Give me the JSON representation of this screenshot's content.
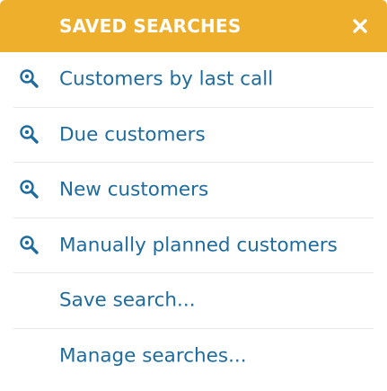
{
  "header": {
    "title": "SAVED SEARCHES",
    "close_icon": "close-icon"
  },
  "colors": {
    "header_bg": "#edaf2c",
    "header_text": "#ffffff",
    "link_text": "#1e6b9e",
    "divider": "#e7e9ec"
  },
  "saved_searches": [
    {
      "label": "Customers by last call",
      "icon": "search-icon"
    },
    {
      "label": "Due customers",
      "icon": "search-icon"
    },
    {
      "label": "New customers",
      "icon": "search-icon"
    },
    {
      "label": "Manually planned customers",
      "icon": "search-icon"
    }
  ],
  "actions": {
    "save_label": "Save search...",
    "manage_label": "Manage searches..."
  }
}
